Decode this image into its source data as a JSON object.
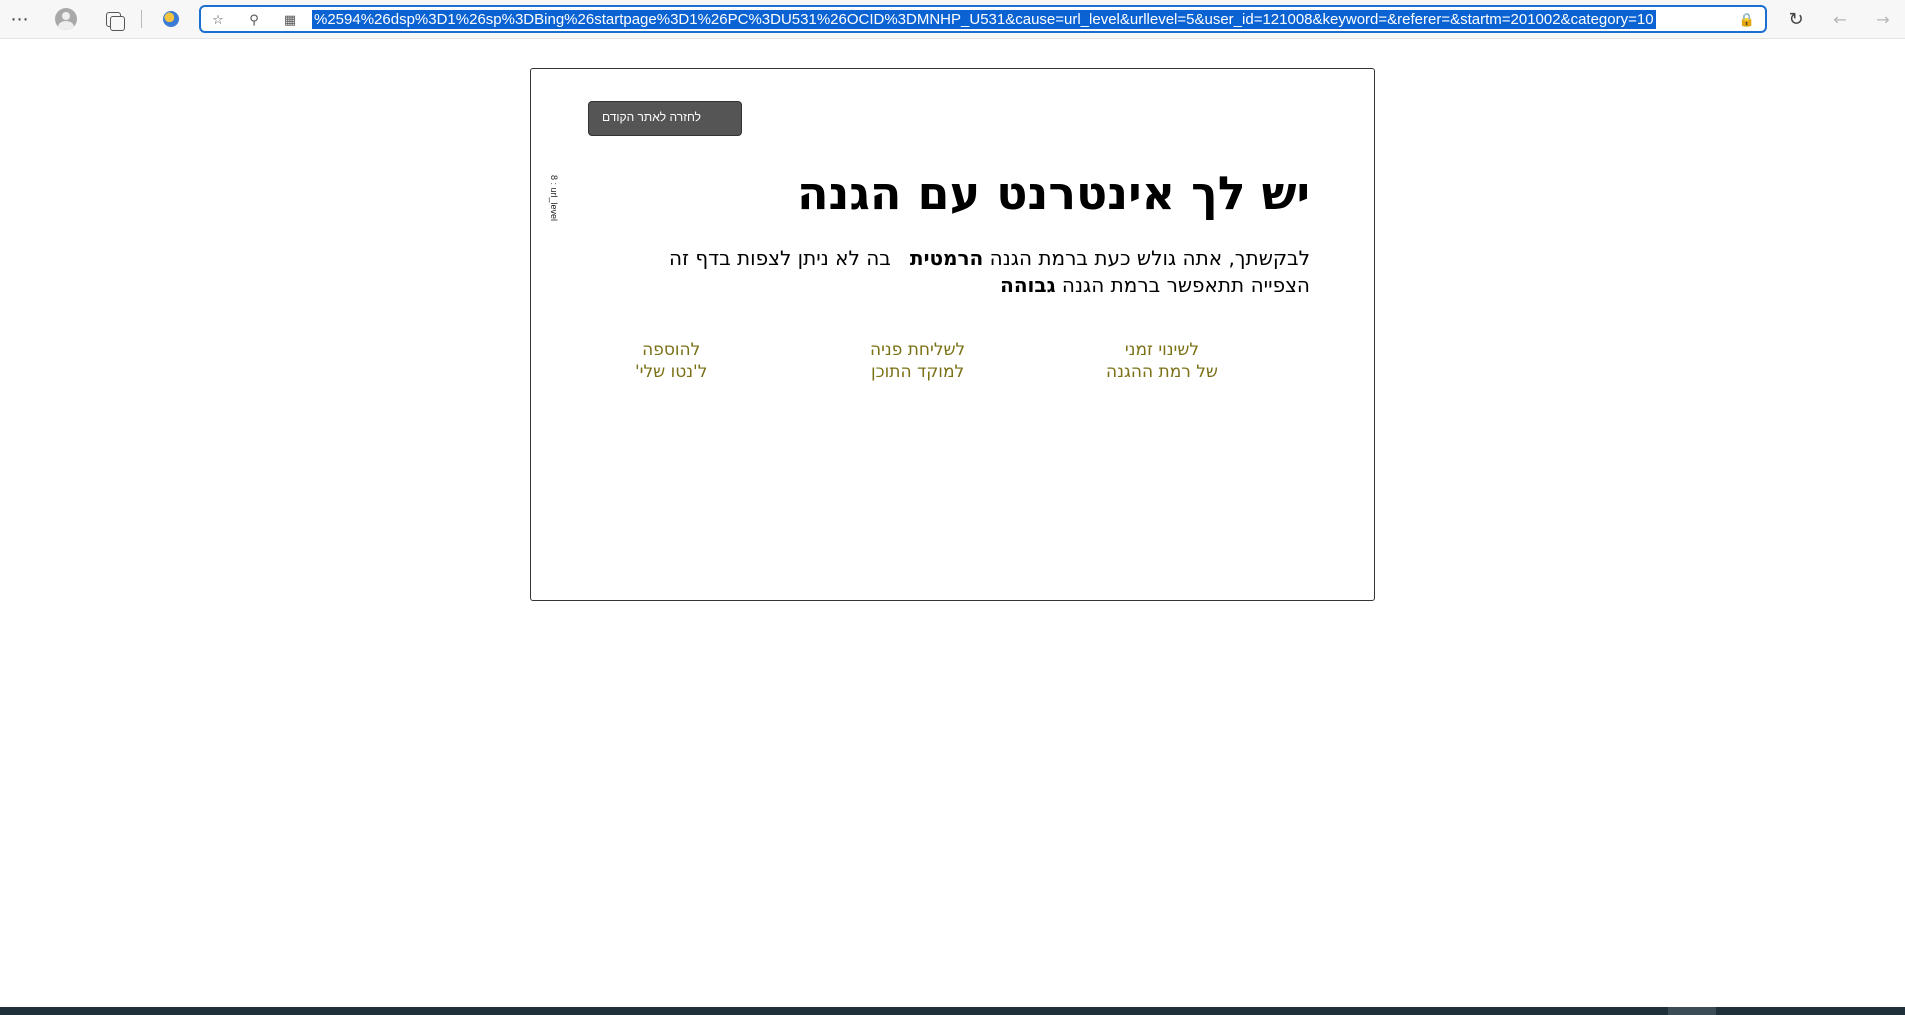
{
  "browser": {
    "url": "%2594%26dsp%3D1%26sp%3DBing%26startpage%3D1%26PC%3DU531%26OCID%3DMNHP_U531&cause=url_level&urllevel=5&user_id=121008&keyword=&referer=&startm=201002&category=10",
    "icons": {
      "more": "more-icon",
      "profile": "profile-icon",
      "collections": "collections-icon",
      "extension": "extension-icon",
      "favorite": "add-favorite-icon",
      "zoom": "zoom-icon",
      "apps": "apps-icon",
      "lock": "lock-icon",
      "reload": "reload-icon",
      "back": "back-arrow-icon",
      "forward": "forward-arrow-icon"
    },
    "accent_color": "#0a62d3"
  },
  "page": {
    "back_button": "לחזרה לאתר הקודם",
    "vertical_code": "8 : url_level",
    "title": "יש לך אינטרנט עם הגנה",
    "desc_line1_pre": "לבקשתך, אתה גולש כעת ברמת הגנה ",
    "desc_line1_bold": "הרמטית",
    "desc_line1_post": "   בה לא ניתן לצפות בדף זה",
    "desc_line2_pre": "הצפייה תתאפשר ברמת הגנה ",
    "desc_line2_bold": "גבוהה",
    "links": [
      {
        "line1": "לשינוי זמני",
        "line2": "של רמת ההגנה"
      },
      {
        "line1": "לשליחת פניה",
        "line2": "למוקד התוכן"
      },
      {
        "line1": "להוספה",
        "line2": "ל'נטו שלי'"
      }
    ],
    "link_color": "#7a7015",
    "button_color": "#555555"
  }
}
